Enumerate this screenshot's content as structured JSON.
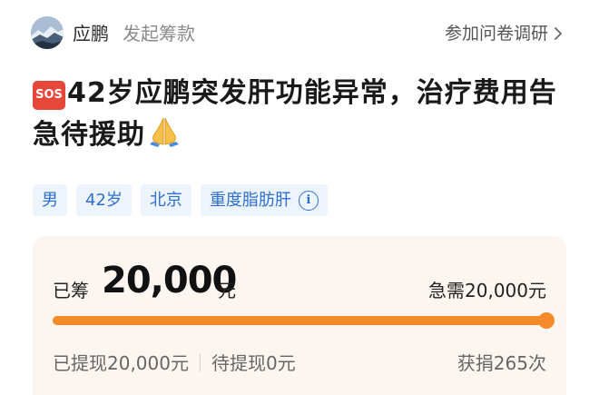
{
  "header": {
    "name": "应鹏",
    "role": "发起筹款",
    "survey_link": "参加问卷调研"
  },
  "title": {
    "badge": "SOS",
    "text": "42岁应鹏突发肝功能异常，治疗费用告急待援助"
  },
  "tags": [
    "男",
    "42岁",
    "北京",
    "重度脂肪肝"
  ],
  "fund": {
    "raised_label": "已筹",
    "raised_amount": "20,000",
    "raised_unit": "元",
    "goal_text": "急需20,000元",
    "progress_fraction": 1.0,
    "withdrawn_text": "已提现20,000元",
    "pending_text": "待提现0元",
    "donations_text": "获捐265次"
  },
  "colors": {
    "accent_orange": "#f48a2a",
    "tag_blue": "#2e6fd1",
    "tag_bg": "#eef4fc",
    "card_bg": "#fdf6f0",
    "sos_red": "#e5483a"
  },
  "icons": {
    "avatar": "mountain-landscape-avatar",
    "survey_arrow": "chevron-right-icon",
    "title_badge": "sos-icon",
    "title_emoji": "praying-hands-icon",
    "tag_info": "info-icon"
  }
}
